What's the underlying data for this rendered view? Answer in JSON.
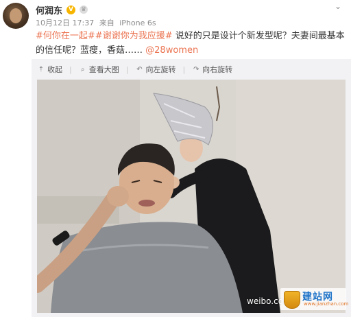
{
  "user": {
    "name": "何润东",
    "verified_mark": "V",
    "vip_mark": "♛"
  },
  "meta": {
    "date": "10月12日 17:37",
    "source_prefix": "来自",
    "source": "iPhone 6s"
  },
  "post": {
    "hashtag1": "#何你在一起#",
    "hashtag2": "#谢谢你为我应援#",
    "text1": " 说好的只是设计个新发型呢？夫妻间最基本的信任呢？蓝瘦，香菇……",
    "mention": "@28women"
  },
  "toolbar": {
    "collapse_label": "收起",
    "view_large_label": "查看大图",
    "rotate_left_label": "向左旋转",
    "rotate_right_label": "向右旋转"
  },
  "icons": {
    "chevron": "chevron-down-icon",
    "collapse": "collapse-arrow-icon",
    "magnify": "magnify-icon",
    "rotate_left": "rotate-left-icon",
    "rotate_right": "rotate-right-icon"
  },
  "watermark": {
    "site_text": "weibo.com/",
    "logo_name": "建站网",
    "logo_url": "www.jianzhan.com"
  },
  "colors": {
    "hashtag": "#eb7350",
    "background_card": "#f2f2f5"
  }
}
